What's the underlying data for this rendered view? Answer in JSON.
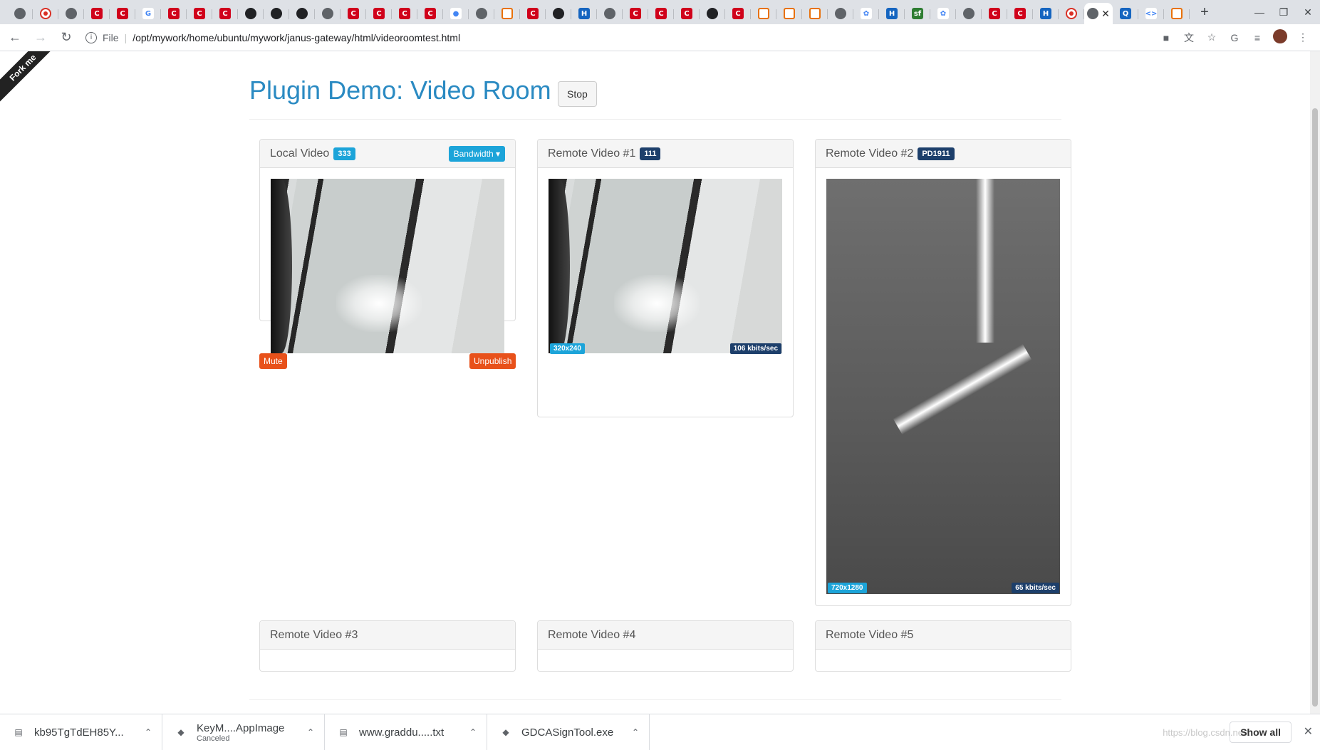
{
  "browser": {
    "favicons": [
      "globe",
      "rec",
      "cloud",
      "red",
      "red",
      "google",
      "red",
      "red",
      "red",
      "ghost",
      "github",
      "github",
      "globe",
      "red",
      "red",
      "red",
      "red",
      "drop",
      "cloud",
      "stack",
      "red",
      "github",
      "h",
      "globe",
      "red",
      "red",
      "red",
      "ghost",
      "red",
      "link",
      "link",
      "link",
      "globe",
      "paw",
      "h",
      "sf",
      "paw",
      "cloud",
      "red",
      "red",
      "h",
      "rec"
    ],
    "active_tab_close": "✕",
    "new_tab": "+",
    "scheme": "File",
    "url": "/opt/mywork/home/ubuntu/mywork/janus-gateway/html/videoroomtest.html"
  },
  "page": {
    "ribbon": "Fork me",
    "title": "Plugin Demo: Video Room",
    "stop_label": "Stop"
  },
  "panels": {
    "local": {
      "title": "Local Video",
      "badge": "333",
      "bandwidth_label": "Bandwidth",
      "mute_label": "Mute",
      "unpublish_label": "Unpublish"
    },
    "remote1": {
      "title": "Remote Video #1",
      "badge": "111",
      "resolution": "320x240",
      "bitrate": "106 kbits/sec"
    },
    "remote2": {
      "title": "Remote Video #2",
      "badge": "PD1911",
      "resolution": "720x1280",
      "bitrate": "65 kbits/sec"
    },
    "remote3": {
      "title": "Remote Video #3"
    },
    "remote4": {
      "title": "Remote Video #4"
    },
    "remote5": {
      "title": "Remote Video #5"
    }
  },
  "downloads": {
    "items": [
      {
        "name": "kb95TgTdEH85Y...",
        "status": ""
      },
      {
        "name": "KeyM....AppImage",
        "status": "Canceled"
      },
      {
        "name": "www.graddu.....txt",
        "status": ""
      },
      {
        "name": "GDCASignTool.exe",
        "status": ""
      }
    ],
    "show_all": "Show all",
    "watermark": "https://blog.csdn.net/..."
  }
}
